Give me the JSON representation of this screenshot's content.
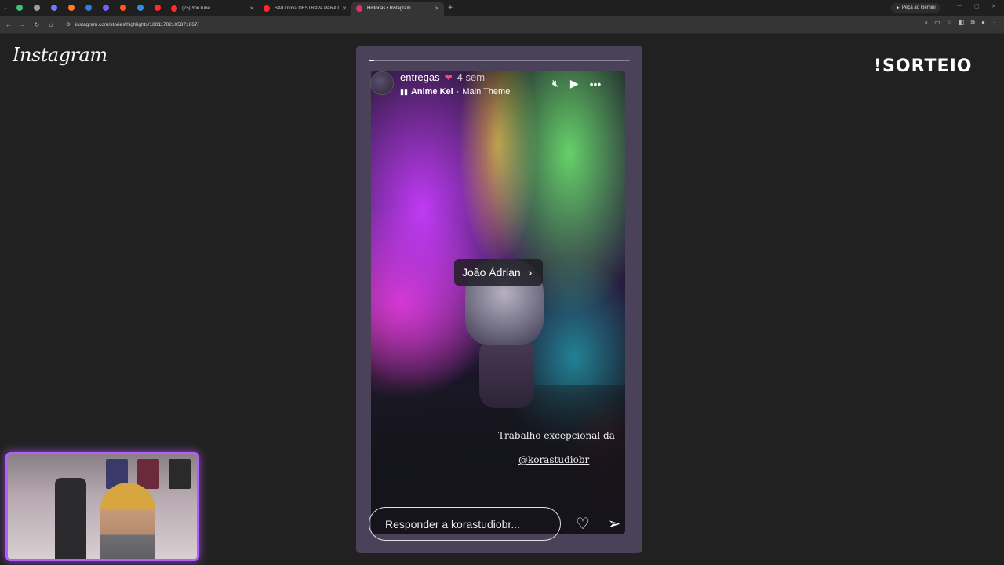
{
  "browser": {
    "pinned_tabs": [
      {
        "icon": "green-arrows-icon",
        "color": "#3fbf7f"
      },
      {
        "icon": "grey-circle-icon",
        "color": "#9e9e9e"
      },
      {
        "icon": "discord-icon",
        "color": "#6d7bff"
      },
      {
        "icon": "orange-game-icon",
        "color": "#ff7a2b"
      },
      {
        "icon": "blue-play-icon",
        "color": "#2a7de1"
      },
      {
        "icon": "purple-icon",
        "color": "#7a5cff"
      },
      {
        "icon": "orange-tab-icon",
        "color": "#ff5a1f"
      },
      {
        "icon": "blue-square-icon",
        "color": "#2b8fe6"
      },
      {
        "icon": "red-youtube-icon",
        "color": "#ff2a2a"
      }
    ],
    "tabs": [
      {
        "title": "(75) YouTube",
        "icon_color": "#ff2a2a",
        "active": false
      },
      {
        "title": "SAIU nova DESTRAVA PARA O...",
        "icon_color": "#ff2a2a",
        "active": false
      },
      {
        "title": "Histórias • Instagram",
        "icon_color": "#e1306c",
        "active": true
      }
    ],
    "gemini_label": "Peça ao Gemini",
    "url": "instagram.com/stories/highlights/18011702105871667/"
  },
  "page": {
    "logo": "Instagram",
    "overlay_brand": "!SORTEIO"
  },
  "story": {
    "progress_fraction": 0.02,
    "username": "entregas",
    "heart": "❤",
    "time": "4 sem",
    "music_artist": "Anime Kei",
    "music_separator": "·",
    "music_track": "Main Theme",
    "mention": "João Ádrian",
    "caption_line1": "Trabalho excepcional da",
    "caption_line2": "@korastudiobr",
    "reply_placeholder": "Responder a korastudiobr...",
    "colors": {
      "frame": "#4a4258",
      "accent": "#b75cff"
    }
  }
}
